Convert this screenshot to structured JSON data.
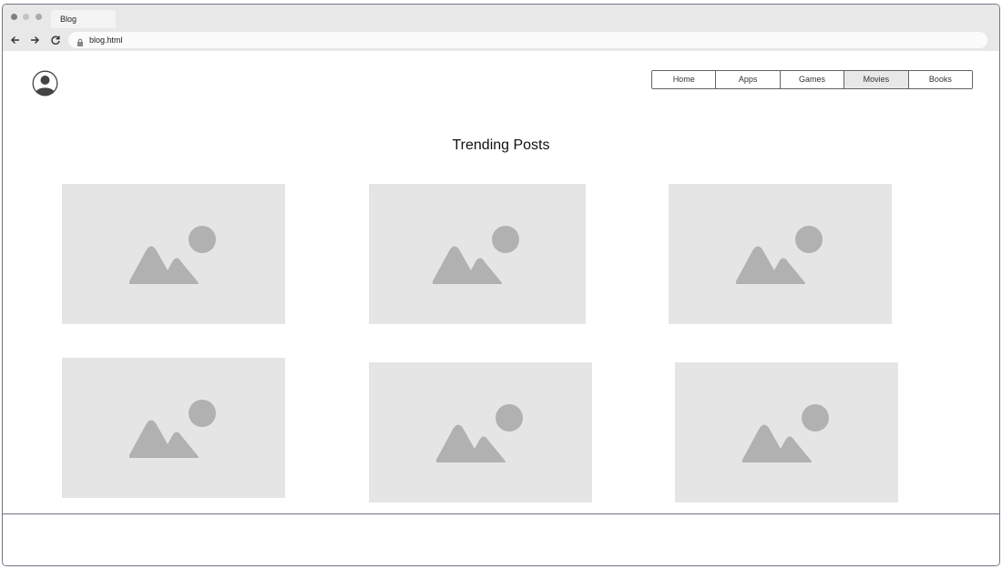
{
  "browser": {
    "tab_title": "Blog",
    "url": "blog.html",
    "icons": [
      "back-arrow-icon",
      "forward-arrow-icon",
      "reload-icon",
      "lock-icon"
    ]
  },
  "header": {
    "avatar_icon": "user-avatar-icon",
    "nav": [
      "Home",
      "Apps",
      "Games",
      "Movies",
      "Books"
    ],
    "active_nav": "Movies"
  },
  "main": {
    "title": "Trending Posts",
    "post_count": 6,
    "placeholder_icon": "image-placeholder-icon"
  },
  "colors": {
    "placeholder_bg": "#e5e5e5",
    "placeholder_fg": "#b1b1b1",
    "active_nav_bg": "#e8e8e8",
    "border": "#5f6369"
  }
}
